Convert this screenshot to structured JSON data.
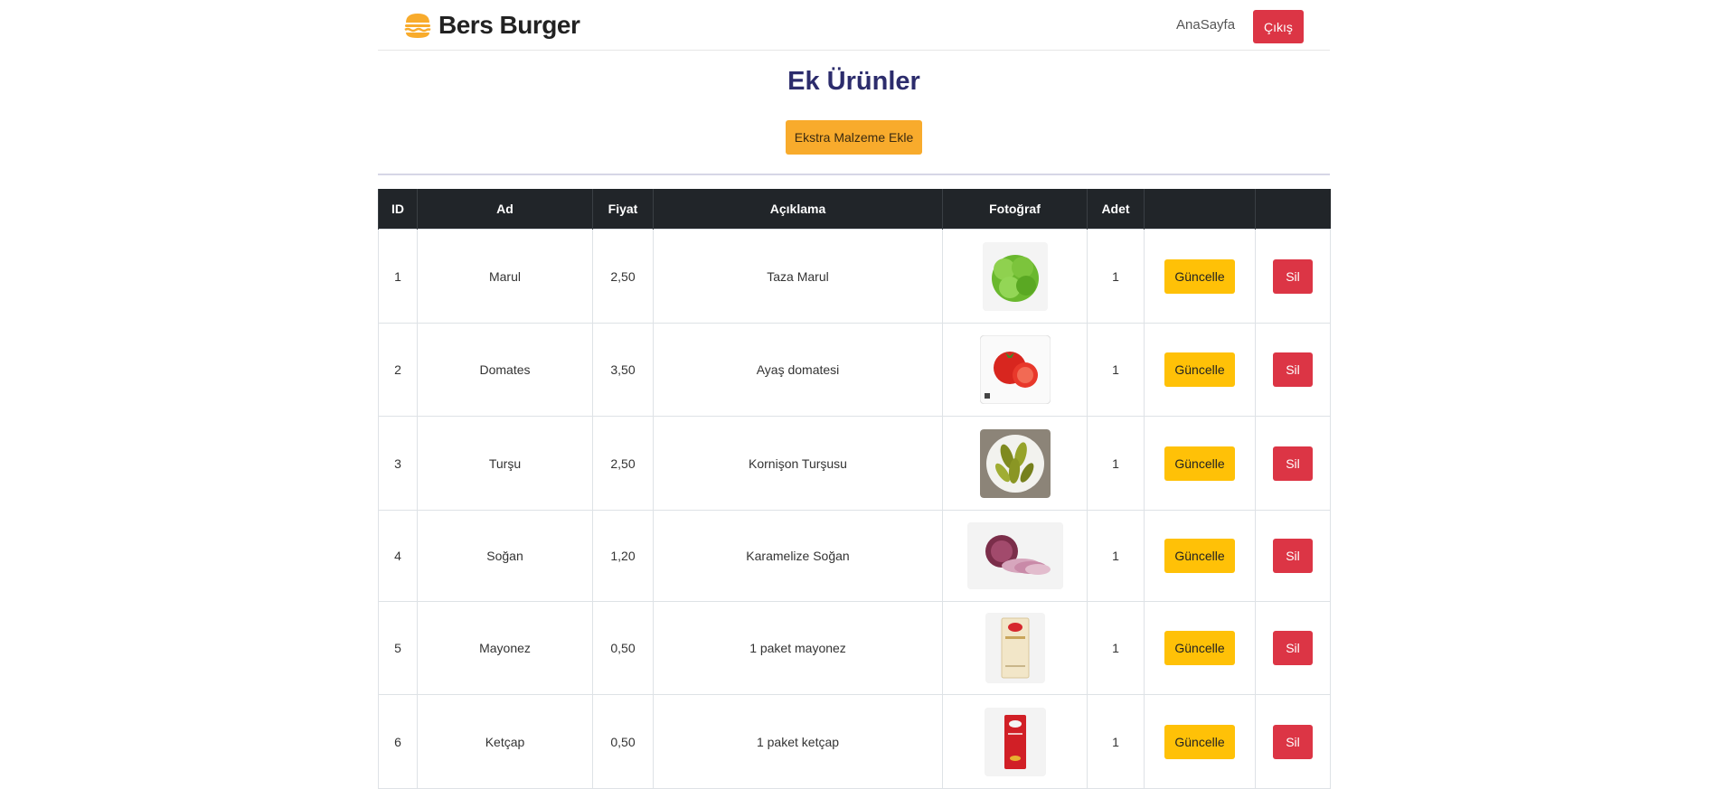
{
  "navbar": {
    "brand": "Bers Burger",
    "brand_icon": "burger-icon",
    "home_link": "AnaSayfa",
    "logout_button": "Çıkış"
  },
  "page": {
    "title": "Ek Ürünler",
    "add_button": "Ekstra Malzeme Ekle"
  },
  "table": {
    "headers": [
      "ID",
      "Ad",
      "Fiyat",
      "Açıklama",
      "Fotoğraf",
      "Adet",
      "",
      ""
    ],
    "update_label": "Güncelle",
    "delete_label": "Sil",
    "rows": [
      {
        "id": "1",
        "name": "Marul",
        "price": "2,50",
        "description": "Taza Marul",
        "photo": "lettuce-photo",
        "qty": "1"
      },
      {
        "id": "2",
        "name": "Domates",
        "price": "3,50",
        "description": "Ayaş domatesi",
        "photo": "tomato-photo",
        "qty": "1"
      },
      {
        "id": "3",
        "name": "Turşu",
        "price": "2,50",
        "description": "Kornişon Turşusu",
        "photo": "pickles-photo",
        "qty": "1"
      },
      {
        "id": "4",
        "name": "Soğan",
        "price": "1,20",
        "description": "Karamelize Soğan",
        "photo": "onion-photo",
        "qty": "1"
      },
      {
        "id": "5",
        "name": "Mayonez",
        "price": "0,50",
        "description": "1 paket mayonez",
        "photo": "mayonnaise-packet-photo",
        "qty": "1"
      },
      {
        "id": "6",
        "name": "Ketçap",
        "price": "0,50",
        "description": "1 paket ketçap",
        "photo": "ketchup-packet-photo",
        "qty": "1"
      }
    ]
  },
  "colors": {
    "brand_orange": "#f8ab2c",
    "danger": "#dc3545",
    "warning": "#ffc107",
    "title_navy": "#2c2c6c",
    "table_header": "#212529"
  }
}
